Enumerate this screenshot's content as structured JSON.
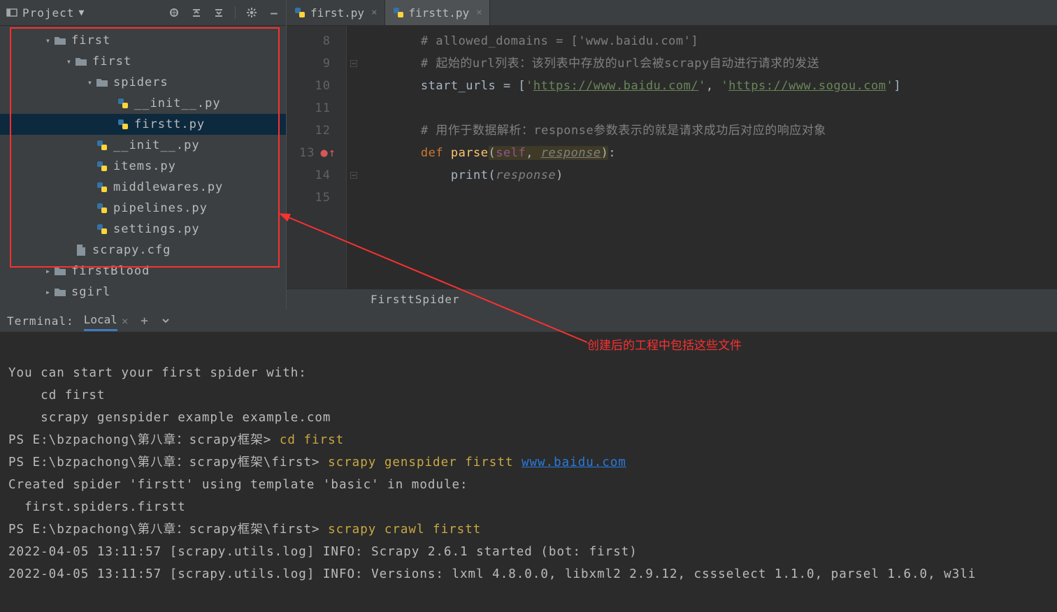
{
  "sidebar": {
    "title": "Project",
    "icons": {
      "dropdown": "▾",
      "target": "target",
      "collapse": "collapse",
      "expand": "expand",
      "gear": "gear",
      "hide": "—"
    },
    "tree": [
      {
        "type": "dir",
        "label": "first",
        "depth": 0,
        "expanded": true,
        "chev": "down"
      },
      {
        "type": "dir",
        "label": "first",
        "depth": 1,
        "expanded": true,
        "chev": "down"
      },
      {
        "type": "dir",
        "label": "spiders",
        "depth": 2,
        "expanded": true,
        "chev": "down"
      },
      {
        "type": "py",
        "label": "__init__.py",
        "depth": 3
      },
      {
        "type": "py",
        "label": "firstt.py",
        "depth": 3,
        "selected": true
      },
      {
        "type": "py",
        "label": "__init__.py",
        "depth": 2
      },
      {
        "type": "py",
        "label": "items.py",
        "depth": 2
      },
      {
        "type": "py",
        "label": "middlewares.py",
        "depth": 2
      },
      {
        "type": "py",
        "label": "pipelines.py",
        "depth": 2
      },
      {
        "type": "py",
        "label": "settings.py",
        "depth": 2
      },
      {
        "type": "cfg",
        "label": "scrapy.cfg",
        "depth": 1
      },
      {
        "type": "dir",
        "label": "firstBlood",
        "depth": 0,
        "expanded": false,
        "chev": "right"
      },
      {
        "type": "dir",
        "label": "sgirl",
        "depth": 0,
        "expanded": false,
        "chev": "right"
      }
    ]
  },
  "tabs": [
    {
      "label": "first.py",
      "active": false
    },
    {
      "label": "firstt.py",
      "active": true
    }
  ],
  "code": {
    "lines": [
      {
        "n": 8,
        "segs": [
          [
            "p",
            "        "
          ],
          [
            "cmt",
            "# allowed_domains = ['www.baidu.com']"
          ]
        ]
      },
      {
        "n": 9,
        "fold": "up",
        "segs": [
          [
            "p",
            "        "
          ],
          [
            "cmt",
            "# 起始的url列表：该列表中存放的url会被scrapy自动进行请求的发送"
          ]
        ]
      },
      {
        "n": 10,
        "segs": [
          [
            "p",
            "        "
          ],
          [
            "id",
            "start_urls = ["
          ],
          [
            "str",
            "'"
          ],
          [
            "url",
            "https://www.baidu.com/"
          ],
          [
            "str",
            "'"
          ],
          [
            "id",
            ", "
          ],
          [
            "str",
            "'"
          ],
          [
            "url",
            "https://www.sogou.com"
          ],
          [
            "str",
            "'"
          ],
          [
            "id",
            "]"
          ]
        ]
      },
      {
        "n": 11,
        "segs": []
      },
      {
        "n": 12,
        "segs": [
          [
            "p",
            "        "
          ],
          [
            "cmt",
            "# 用作于数据解析：response参数表示的就是请求成功后对应的响应对象"
          ]
        ]
      },
      {
        "n": 13,
        "mark": "●↑",
        "segs": [
          [
            "p",
            "        "
          ],
          [
            "kw",
            "def "
          ],
          [
            "fn",
            "parse"
          ],
          [
            "hl",
            "("
          ],
          [
            "self",
            "self"
          ],
          [
            "hl",
            ", "
          ],
          [
            "param",
            "response"
          ],
          [
            "hl",
            ")"
          ],
          [
            "id",
            ":"
          ]
        ]
      },
      {
        "n": 14,
        "fold": "up",
        "segs": [
          [
            "p",
            "            "
          ],
          [
            "call",
            "print"
          ],
          [
            "id",
            "("
          ],
          [
            "ital",
            "response"
          ],
          [
            "id",
            ")"
          ]
        ]
      },
      {
        "n": 15,
        "segs": []
      }
    ],
    "breadcrumb": "FirsttSpider"
  },
  "terminal": {
    "tabTitle": "Terminal:",
    "tabName": "Local",
    "lines": [
      [
        [
          "t",
          ""
        ]
      ],
      [
        [
          "t",
          "You can start your first spider with:"
        ]
      ],
      [
        [
          "t",
          "    cd first"
        ]
      ],
      [
        [
          "t",
          "    scrapy genspider example example.com"
        ]
      ],
      [
        [
          "t",
          "PS E:\\bzpachong\\第八章：scrapy框架> "
        ],
        [
          "cmd",
          "cd first"
        ]
      ],
      [
        [
          "t",
          "PS E:\\bzpachong\\第八章：scrapy框架\\first> "
        ],
        [
          "cmd",
          "scrapy genspider firstt "
        ],
        [
          "url",
          "www.baidu.com"
        ]
      ],
      [
        [
          "t",
          "Created spider 'firstt' using template 'basic' in module:"
        ]
      ],
      [
        [
          "t",
          "  first.spiders.firstt"
        ]
      ],
      [
        [
          "t",
          "PS E:\\bzpachong\\第八章：scrapy框架\\first> "
        ],
        [
          "cmd",
          "scrapy crawl firstt"
        ]
      ],
      [
        [
          "t",
          "2022-04-05 13:11:57 [scrapy.utils.log] INFO: Scrapy 2.6.1 started (bot: first)"
        ]
      ],
      [
        [
          "t",
          "2022-04-05 13:11:57 [scrapy.utils.log] INFO: Versions: lxml 4.8.0.0, libxml2 2.9.12, cssselect 1.1.0, parsel 1.6.0, w3li"
        ]
      ]
    ]
  },
  "annotation": {
    "text": "创建后的工程中包括这些文件"
  }
}
